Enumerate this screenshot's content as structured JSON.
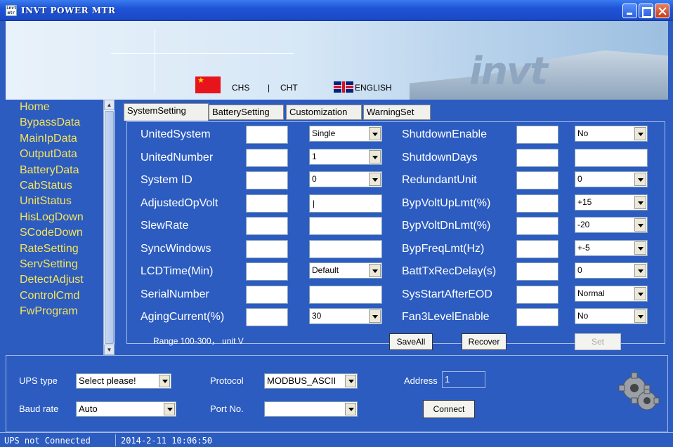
{
  "window": {
    "title": "INVT POWER MTR"
  },
  "banner": {
    "lang_chs": "CHS",
    "lang_sep": "|",
    "lang_cht": "CHT",
    "lang_en": "ENGLISH",
    "logo": "invt"
  },
  "sidebar": {
    "items": [
      "Home",
      "BypassData",
      "MainIpData",
      "OutputData",
      "BatteryData",
      "CabStatus",
      "UnitStatus",
      "HisLogDown",
      "SCodeDown",
      "RateSetting",
      "ServSetting",
      "DetectAdjust",
      "ControlCmd",
      "FwProgram"
    ]
  },
  "tabs": [
    "SystemSetting",
    "BatterySetting",
    "Customization",
    "WarningSet"
  ],
  "form": {
    "left": [
      {
        "label": "UnitedSystem",
        "value": "Single",
        "type": "select"
      },
      {
        "label": "UnitedNumber",
        "value": "1",
        "type": "select"
      },
      {
        "label": "System ID",
        "value": "0",
        "type": "select"
      },
      {
        "label": "AdjustedOpVolt",
        "value": "|",
        "type": "text"
      },
      {
        "label": "SlewRate",
        "value": "",
        "type": "text"
      },
      {
        "label": "SyncWindows",
        "value": "",
        "type": "text"
      },
      {
        "label": "LCDTime(Min)",
        "value": "Default",
        "type": "select"
      },
      {
        "label": "SerialNumber",
        "value": "",
        "type": "text"
      },
      {
        "label": "AgingCurrent(%)",
        "value": "30",
        "type": "select"
      }
    ],
    "right": [
      {
        "label": "ShutdownEnable",
        "value": "No",
        "type": "select"
      },
      {
        "label": "ShutdownDays",
        "value": "",
        "type": "text"
      },
      {
        "label": "RedundantUnit",
        "value": "0",
        "type": "select"
      },
      {
        "label": "BypVoltUpLmt(%)",
        "value": "+15",
        "type": "select"
      },
      {
        "label": "BypVoltDnLmt(%)",
        "value": "-20",
        "type": "select"
      },
      {
        "label": "BypFreqLmt(Hz)",
        "value": "+-5",
        "type": "select"
      },
      {
        "label": "BattTxRecDelay(s)",
        "value": "0",
        "type": "select"
      },
      {
        "label": "SysStartAfterEOD",
        "value": "Normal",
        "type": "select"
      },
      {
        "label": "Fan3LevelEnable",
        "value": "No",
        "type": "select"
      }
    ],
    "hint": "Range 100-300， unit V",
    "buttons": {
      "save_all": "SaveAll",
      "recover": "Recover",
      "set": "Set"
    }
  },
  "connection": {
    "ups_type_label": "UPS type",
    "ups_type_value": "Select please!",
    "baud_label": "Baud rate",
    "baud_value": "Auto",
    "protocol_label": "Protocol",
    "protocol_value": "MODBUS_ASCII",
    "port_label": "Port No.",
    "port_value": "",
    "address_label": "Address",
    "address_value": "1",
    "connect_label": "Connect"
  },
  "status": {
    "connection": "UPS not Connected",
    "datetime": "2014-2-11 10:06:50"
  },
  "colors": {
    "background": "#2c5cc0",
    "menu_text": "#f5e35b",
    "title_bar": "#1f54d6"
  }
}
